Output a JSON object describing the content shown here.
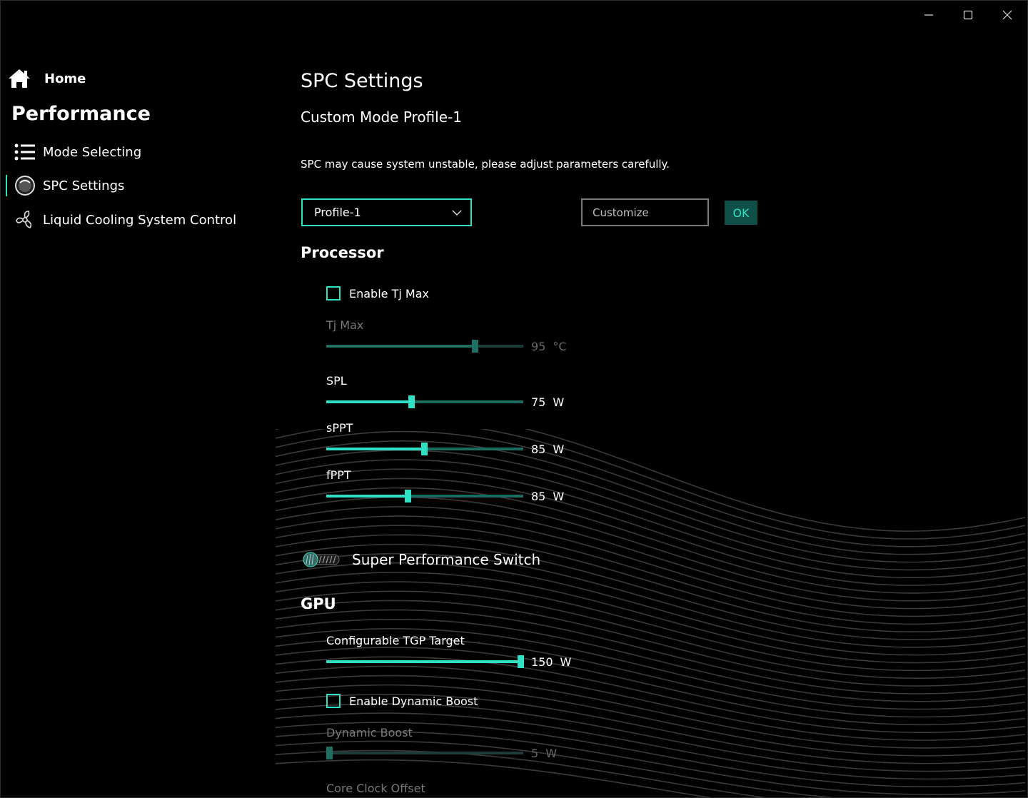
{
  "titlebar": {
    "minimize_icon": "minimize-icon",
    "maximize_icon": "maximize-icon",
    "close_icon": "close-icon"
  },
  "sidebar": {
    "home_label": "Home",
    "section_title": "Performance",
    "items": [
      {
        "label": "Mode Selecting",
        "icon": "list-icon"
      },
      {
        "label": "SPC Settings",
        "icon": "gauge-icon"
      },
      {
        "label": "Liquid Cooling System Control",
        "icon": "fan-icon"
      }
    ]
  },
  "main": {
    "title": "SPC Settings",
    "subtitle": "Custom Mode Profile-1",
    "warning": "SPC may cause system unstable, please adjust parameters carefully.",
    "profile_select": {
      "value": "Profile-1"
    },
    "customize_input": {
      "placeholder": "Customize",
      "value": ""
    },
    "ok_label": "OK",
    "processor": {
      "heading": "Processor",
      "enable_tj_max": {
        "label": "Enable Tj Max",
        "checked": false
      },
      "tj_max": {
        "label": "Tj Max",
        "value": "95",
        "unit": "°C",
        "fraction": 0.76
      },
      "spl": {
        "label": "SPL",
        "value": "75",
        "unit": "W",
        "fraction": 0.43
      },
      "sppt": {
        "label": "sPPT",
        "value": "85",
        "unit": "W",
        "fraction": 0.495
      },
      "fppt": {
        "label": "fPPT",
        "value": "85",
        "unit": "W",
        "fraction": 0.41
      }
    },
    "super_performance": {
      "label": "Super Performance Switch",
      "on": false
    },
    "gpu": {
      "heading": "GPU",
      "tgp": {
        "label": "Configurable TGP Target",
        "value": "150",
        "unit": "W",
        "fraction": 1.0
      },
      "enable_dynamic_boost": {
        "label": "Enable Dynamic Boost",
        "checked": false
      },
      "dynamic_boost": {
        "label": "Dynamic Boost",
        "value": "5",
        "unit": "W",
        "fraction": 0.0
      },
      "core_clock_offset": {
        "label": "Core Clock Offset"
      }
    }
  },
  "colors": {
    "accent": "#2fe0c4",
    "ok_bg": "#0f4f48",
    "track": "#1a6b60"
  }
}
